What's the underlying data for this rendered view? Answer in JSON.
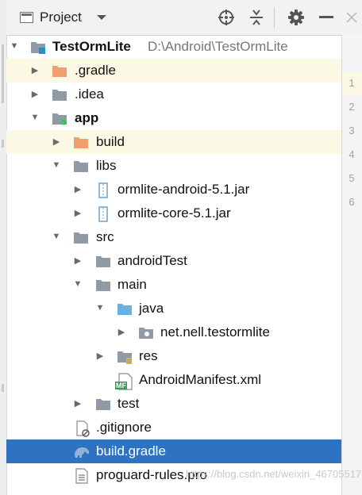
{
  "toolbar": {
    "view_label": "Project",
    "icons": [
      "project-view-icon",
      "dropdown-icon",
      "locate-icon",
      "collapse-all-icon",
      "settings-icon",
      "minimize-icon",
      "close-icon"
    ]
  },
  "tree": {
    "root_name": "TestOrmLite",
    "root_path": "D:\\Android\\TestOrmLite",
    "gradle_dir": ".gradle",
    "idea_dir": ".idea",
    "app_module": "app",
    "build_dir": "build",
    "libs_dir": "libs",
    "jar1": "ormlite-android-5.1.jar",
    "jar2": "ormlite-core-5.1.jar",
    "src_dir": "src",
    "android_test_dir": "androidTest",
    "main_dir": "main",
    "java_dir": "java",
    "package": "net.nell.testormlite",
    "res_dir": "res",
    "manifest": "AndroidManifest.xml",
    "manifest_badge": "MF",
    "test_dir": "test",
    "gitignore": ".gitignore",
    "build_gradle": "build.gradle",
    "proguard": "proguard-rules.pro"
  },
  "gutter": {
    "line_numbers": [
      "1",
      "2",
      "3",
      "4",
      "5",
      "6"
    ]
  },
  "watermark": "https://blog.csdn.net/weixin_46705517",
  "colors": {
    "selection": "#2d73c2",
    "highlight": "#fbf9e3",
    "orange_folder": "#f0a070",
    "folder": "#8f9aa5",
    "source_folder": "#6ab0e0"
  }
}
